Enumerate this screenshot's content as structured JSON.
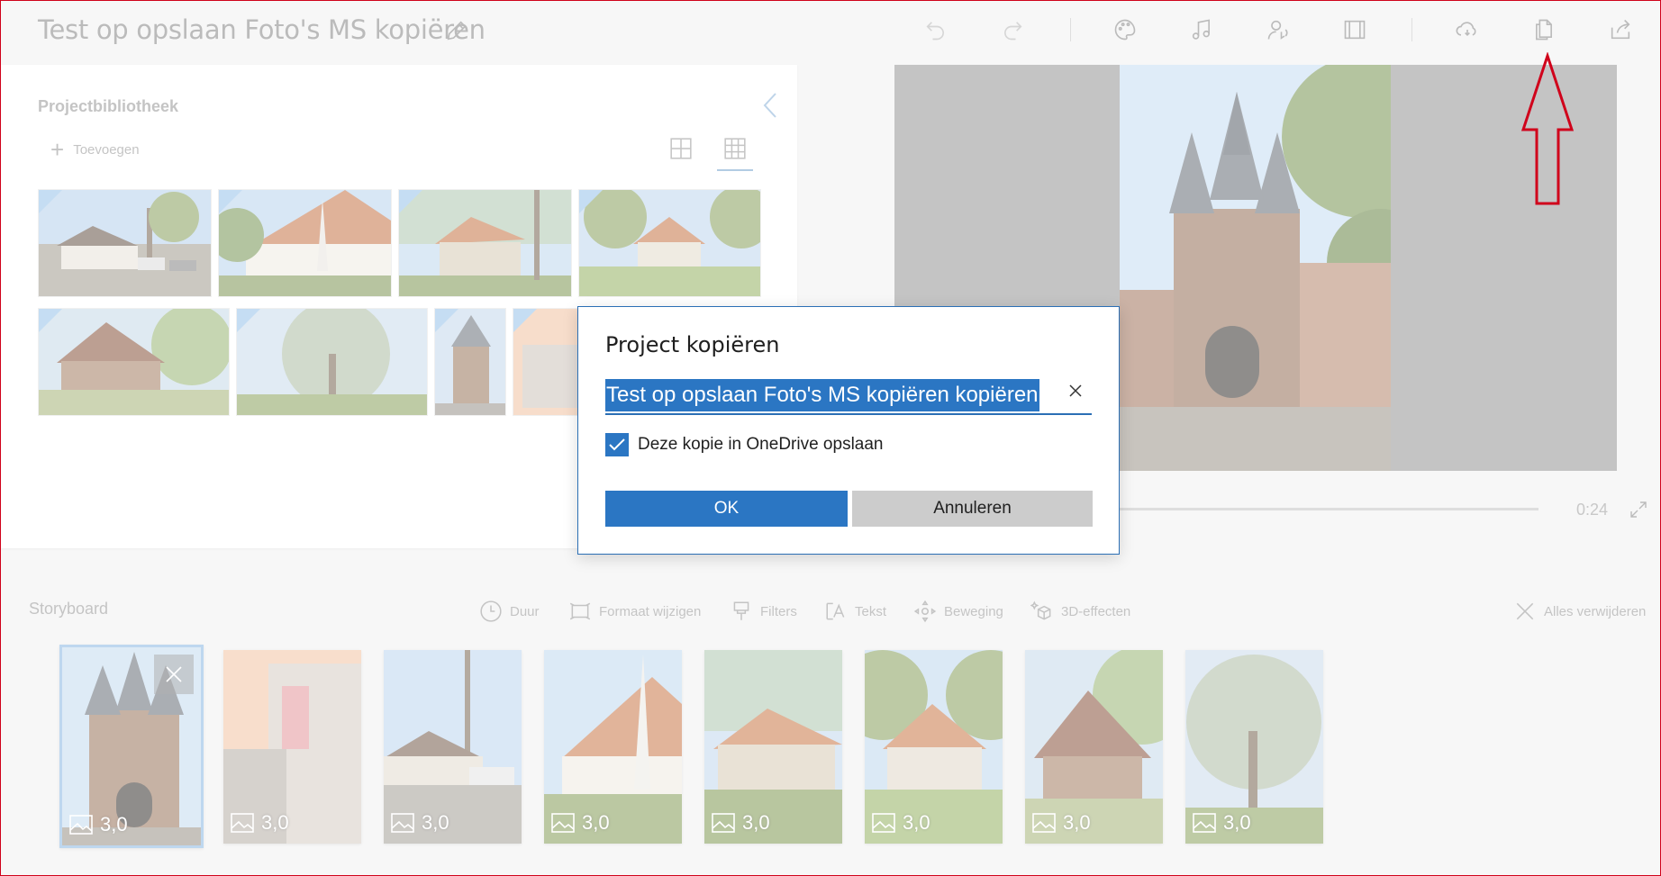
{
  "header": {
    "title": "Test op opslaan Foto's MS kopiëren"
  },
  "library": {
    "title": "Projectbibliotheek",
    "add_label": "Toevoegen"
  },
  "preview": {
    "time": "0:24"
  },
  "storyboard": {
    "title": "Storyboard",
    "tools": [
      "Duur",
      "Formaat wijzigen",
      "Filters",
      "Tekst",
      "Beweging",
      "3D-effecten"
    ],
    "remove_all": "Alles verwijderen",
    "cards": [
      {
        "duration": "3,0"
      },
      {
        "duration": "3,0"
      },
      {
        "duration": "3,0"
      },
      {
        "duration": "3,0"
      },
      {
        "duration": "3,0"
      },
      {
        "duration": "3,0"
      },
      {
        "duration": "3,0"
      },
      {
        "duration": "3,0"
      }
    ]
  },
  "dialog": {
    "title": "Project kopiëren",
    "input_value": "Test op opslaan Foto's MS kopiëren kopiëren",
    "checkbox_label": "Deze kopie in OneDrive opslaan",
    "checkbox_checked": true,
    "ok_label": "OK",
    "cancel_label": "Annuleren"
  },
  "colors": {
    "accent": "#2b76c3",
    "annotation": "#d0021b"
  }
}
